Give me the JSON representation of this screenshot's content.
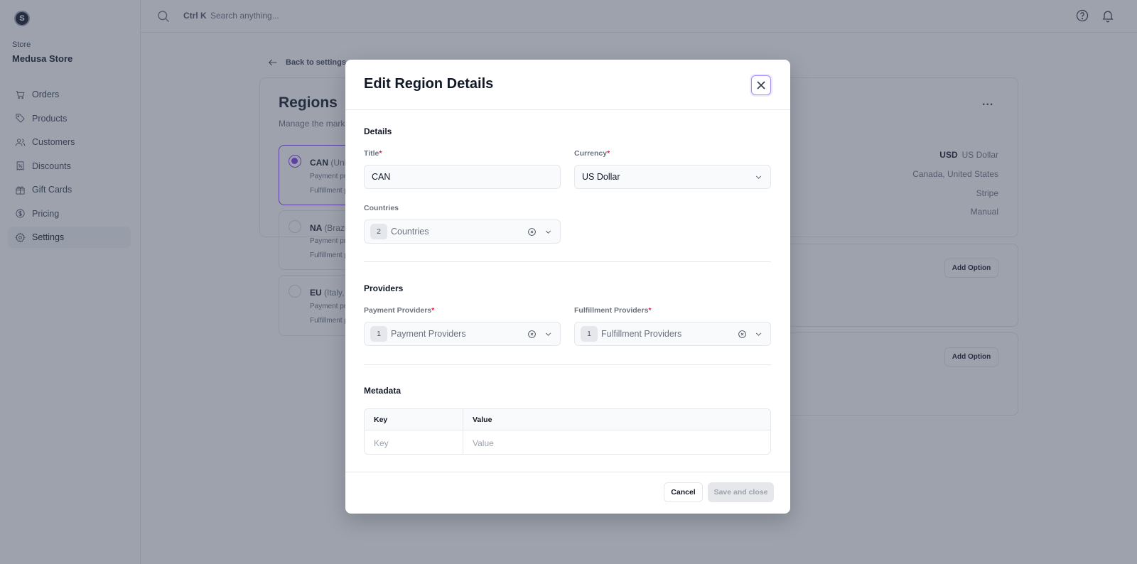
{
  "sidebar": {
    "logo_letter": "S",
    "store_label": "Store",
    "store_name": "Medusa Store",
    "items": [
      {
        "label": "Orders",
        "icon": "cart-icon"
      },
      {
        "label": "Products",
        "icon": "tag-icon"
      },
      {
        "label": "Customers",
        "icon": "users-icon"
      },
      {
        "label": "Discounts",
        "icon": "receipt-percent-icon"
      },
      {
        "label": "Gift Cards",
        "icon": "gift-icon"
      },
      {
        "label": "Pricing",
        "icon": "currency-dollar-icon"
      },
      {
        "label": "Settings",
        "icon": "gear-icon",
        "active": true
      }
    ]
  },
  "topbar": {
    "shortcut": "Ctrl K",
    "search_placeholder": "Search anything..."
  },
  "page": {
    "back_label": "Back to settings",
    "regions_title": "Regions",
    "regions_subtitle": "Manage the markets you will operate within.",
    "regions": [
      {
        "code": "CAN",
        "countries": "(United States, Canada)",
        "payment": "Payment providers: Stripe",
        "fulfillment": "Fulfillment providers: Manual",
        "selected": true
      },
      {
        "code": "NA",
        "countries": "(Brazil)",
        "payment": "Payment providers: Stripe",
        "fulfillment": "Fulfillment providers: Manual",
        "selected": false
      },
      {
        "code": "EU",
        "countries": "(Italy, Germany)",
        "payment": "Payment providers: Stripe",
        "fulfillment": "Fulfillment providers: Manual",
        "selected": false
      }
    ],
    "details": {
      "currency_code": "USD",
      "currency_name": "US Dollar",
      "countries": "Canada, United States",
      "payment": "Stripe",
      "fulfillment": "Manual"
    },
    "add_option_label": "Add Option",
    "more_label": "..."
  },
  "modal": {
    "title": "Edit Region Details",
    "details_section": "Details",
    "title_label": "Title",
    "title_value": "CAN",
    "currency_label": "Currency",
    "currency_value": "US Dollar",
    "countries_label": "Countries",
    "countries_count": "2",
    "countries_placeholder": "Countries",
    "providers_section": "Providers",
    "payment_label": "Payment Providers",
    "payment_count": "1",
    "payment_placeholder": "Payment Providers",
    "fulfillment_label": "Fulfillment Providers",
    "fulfillment_count": "1",
    "fulfillment_placeholder": "Fulfillment Providers",
    "required_mark": "*",
    "metadata_section": "Metadata",
    "meta_key_header": "Key",
    "meta_value_header": "Value",
    "meta_key_placeholder": "Key",
    "meta_value_placeholder": "Value",
    "cancel_label": "Cancel",
    "save_label": "Save and close"
  },
  "colors": {
    "accent": "#7c3aed",
    "required": "#e11d48",
    "overlay": "#3c465c"
  }
}
